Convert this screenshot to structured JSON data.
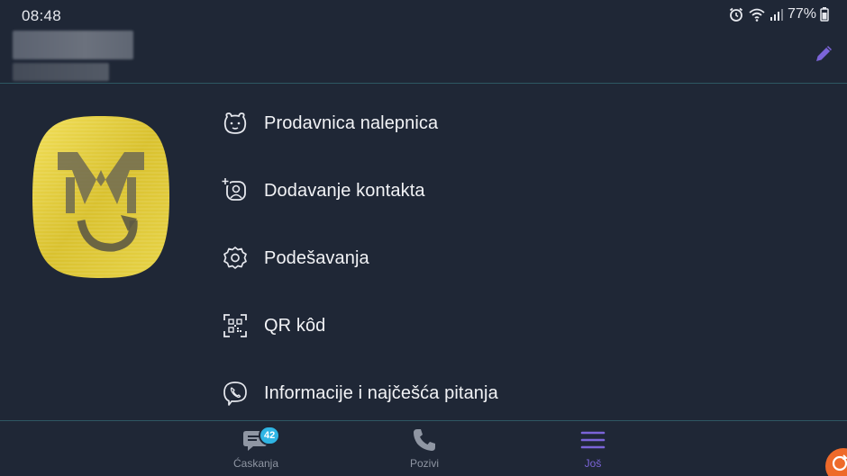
{
  "status_bar": {
    "time": "08:48",
    "battery_percent": "77%",
    "icons": [
      "alarm-icon",
      "wifi-icon",
      "signal-icon",
      "battery-icon"
    ]
  },
  "header": {
    "edit_icon": "pencil-icon"
  },
  "menu": {
    "items": [
      {
        "label": "Prodavnica nalepnica",
        "icon": "sticker-bear-icon"
      },
      {
        "label": "Dodavanje kontakta",
        "icon": "add-contact-icon"
      },
      {
        "label": "Podešavanja",
        "icon": "gear-icon"
      },
      {
        "label": "QR kôd",
        "icon": "qr-code-icon"
      },
      {
        "label": "Informacije i najčešća pitanja",
        "icon": "viber-info-icon"
      }
    ]
  },
  "bottom_nav": {
    "tabs": [
      {
        "label": "Ćaskanja",
        "icon": "chat-icon",
        "badge": "42",
        "active": false
      },
      {
        "label": "Pozivi",
        "icon": "phone-icon",
        "active": false
      },
      {
        "label": "Još",
        "icon": "menu-icon",
        "active": true
      }
    ]
  },
  "colors": {
    "background": "#1f2736",
    "divider": "#2e5763",
    "accent": "#7b64d8",
    "badge": "#2fb5e4",
    "avatar_gold": "#e0cb36"
  }
}
